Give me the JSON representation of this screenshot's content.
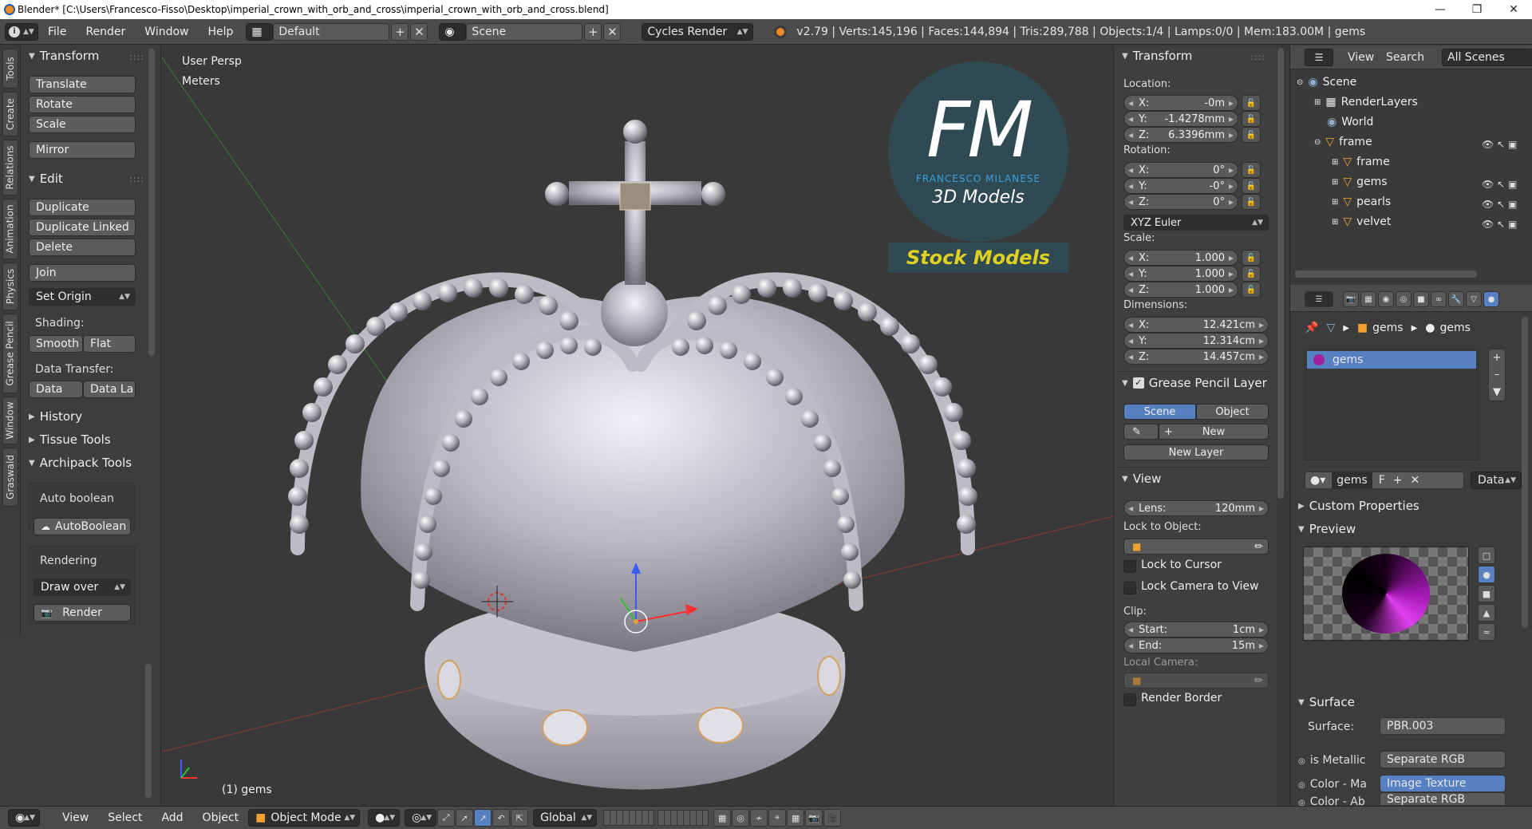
{
  "titlebar": {
    "title": "Blender* [C:\\Users\\Francesco-Fisso\\Desktop\\imperial_crown_with_orb_and_cross\\imperial_crown_with_orb_and_cross.blend]"
  },
  "menu": {
    "file": "File",
    "render": "Render",
    "window": "Window",
    "help": "Help"
  },
  "screen": {
    "layout": "Default",
    "scene": "Scene",
    "engine": "Cycles Render"
  },
  "stats": "v2.79 | Verts:145,196 | Faces:144,894 | Tris:289,788 | Objects:1/4 | Lamps:0/0 | Mem:183.00M | gems",
  "tabs": [
    "Tools",
    "Create",
    "Relations",
    "Animation",
    "Physics",
    "Grease Pencil",
    "Window",
    "Graswald"
  ],
  "tools": {
    "transform_hdr": "Transform",
    "translate": "Translate",
    "rotate": "Rotate",
    "scale": "Scale",
    "mirror": "Mirror",
    "edit_hdr": "Edit",
    "duplicate": "Duplicate",
    "duplicate_linked": "Duplicate Linked",
    "delete": "Delete",
    "join": "Join",
    "set_origin": "Set Origin",
    "shading_lbl": "Shading:",
    "smooth": "Smooth",
    "flat": "Flat",
    "data_transfer_lbl": "Data Transfer:",
    "data": "Data",
    "data_la": "Data La",
    "history_hdr": "History",
    "tissue_hdr": "Tissue Tools",
    "archipack_hdr": "Archipack Tools",
    "auto_boolean_lbl": "Auto boolean",
    "autoboolean_btn": "AutoBoolean",
    "rendering_lbl": "Rendering",
    "draw_over": "Draw over",
    "render_btn": "Render"
  },
  "viewport": {
    "persp": "User Persp",
    "units": "Meters",
    "object_label": "(1) gems",
    "logo": {
      "letters": "FM",
      "name": "FRANCESCO MILANESE",
      "sub": "3D Models",
      "tag": "Stock Models"
    }
  },
  "npanel": {
    "transform_hdr": "Transform",
    "location_lbl": "Location:",
    "loc": {
      "x": "-0m",
      "y": "-1.4278mm",
      "z": "6.3396mm"
    },
    "rotation_lbl": "Rotation:",
    "rot": {
      "x": "0°",
      "y": "-0°",
      "z": "0°"
    },
    "rot_mode": "XYZ Euler",
    "scale_lbl": "Scale:",
    "scl": {
      "x": "1.000",
      "y": "1.000",
      "z": "1.000"
    },
    "dimensions_lbl": "Dimensions:",
    "dim": {
      "x": "12.421cm",
      "y": "12.314cm",
      "z": "14.457cm"
    },
    "axis": {
      "x": "X:",
      "y": "Y:",
      "z": "Z:"
    },
    "gp_hdr": "Grease Pencil Layer",
    "gp_scene": "Scene",
    "gp_object": "Object",
    "gp_new": "New",
    "gp_new_layer": "New Layer",
    "view_hdr": "View",
    "lens_lbl": "Lens:",
    "lens": "120mm",
    "lock_obj_lbl": "Lock to Object:",
    "lock_cursor": "Lock to Cursor",
    "lock_camera": "Lock Camera to View",
    "clip_lbl": "Clip:",
    "clip_start_lbl": "Start:",
    "clip_start": "1cm",
    "clip_end_lbl": "End:",
    "clip_end": "15m",
    "local_camera_lbl": "Local Camera:",
    "render_border": "Render Border"
  },
  "outliner": {
    "view": "View",
    "search": "Search",
    "all_scenes": "All Scenes",
    "items": {
      "scene": "Scene",
      "renderlayers": "RenderLayers",
      "world": "World",
      "frame": "frame",
      "frame_child": "frame",
      "gems": "gems",
      "pearls": "pearls",
      "velvet": "velvet"
    }
  },
  "props": {
    "crumb_obj": "gems",
    "crumb_mat": "gems",
    "slot": "gems",
    "mat_name": "gems",
    "mat_f": "F",
    "data_sel": "Data",
    "custom_props": "Custom Properties",
    "preview": "Preview",
    "surface_hdr": "Surface",
    "surface_lbl": "Surface:",
    "surface_val": "PBR.003",
    "metallic_lbl": "is Metallic",
    "metallic_val": "Separate RGB",
    "colorma_lbl": "Color - Ma",
    "colorma_val": "Image Texture",
    "colorab_lbl": "Color - Ab",
    "colorab_val": "Separate RGB"
  },
  "bottombar": {
    "view": "View",
    "select": "Select",
    "add": "Add",
    "object": "Object",
    "mode": "Object Mode",
    "orientation": "Global"
  },
  "colors": {
    "accent": "#5680c2",
    "bg": "#393939",
    "panel": "#3d3d3d"
  },
  "icons": [
    "info-icon",
    "layout-icon",
    "scene-icon",
    "blender-logo-icon",
    "lock-icon",
    "eye-icon",
    "cursor-icon",
    "camera-icon",
    "eyedropper-icon",
    "sphere-icon"
  ]
}
